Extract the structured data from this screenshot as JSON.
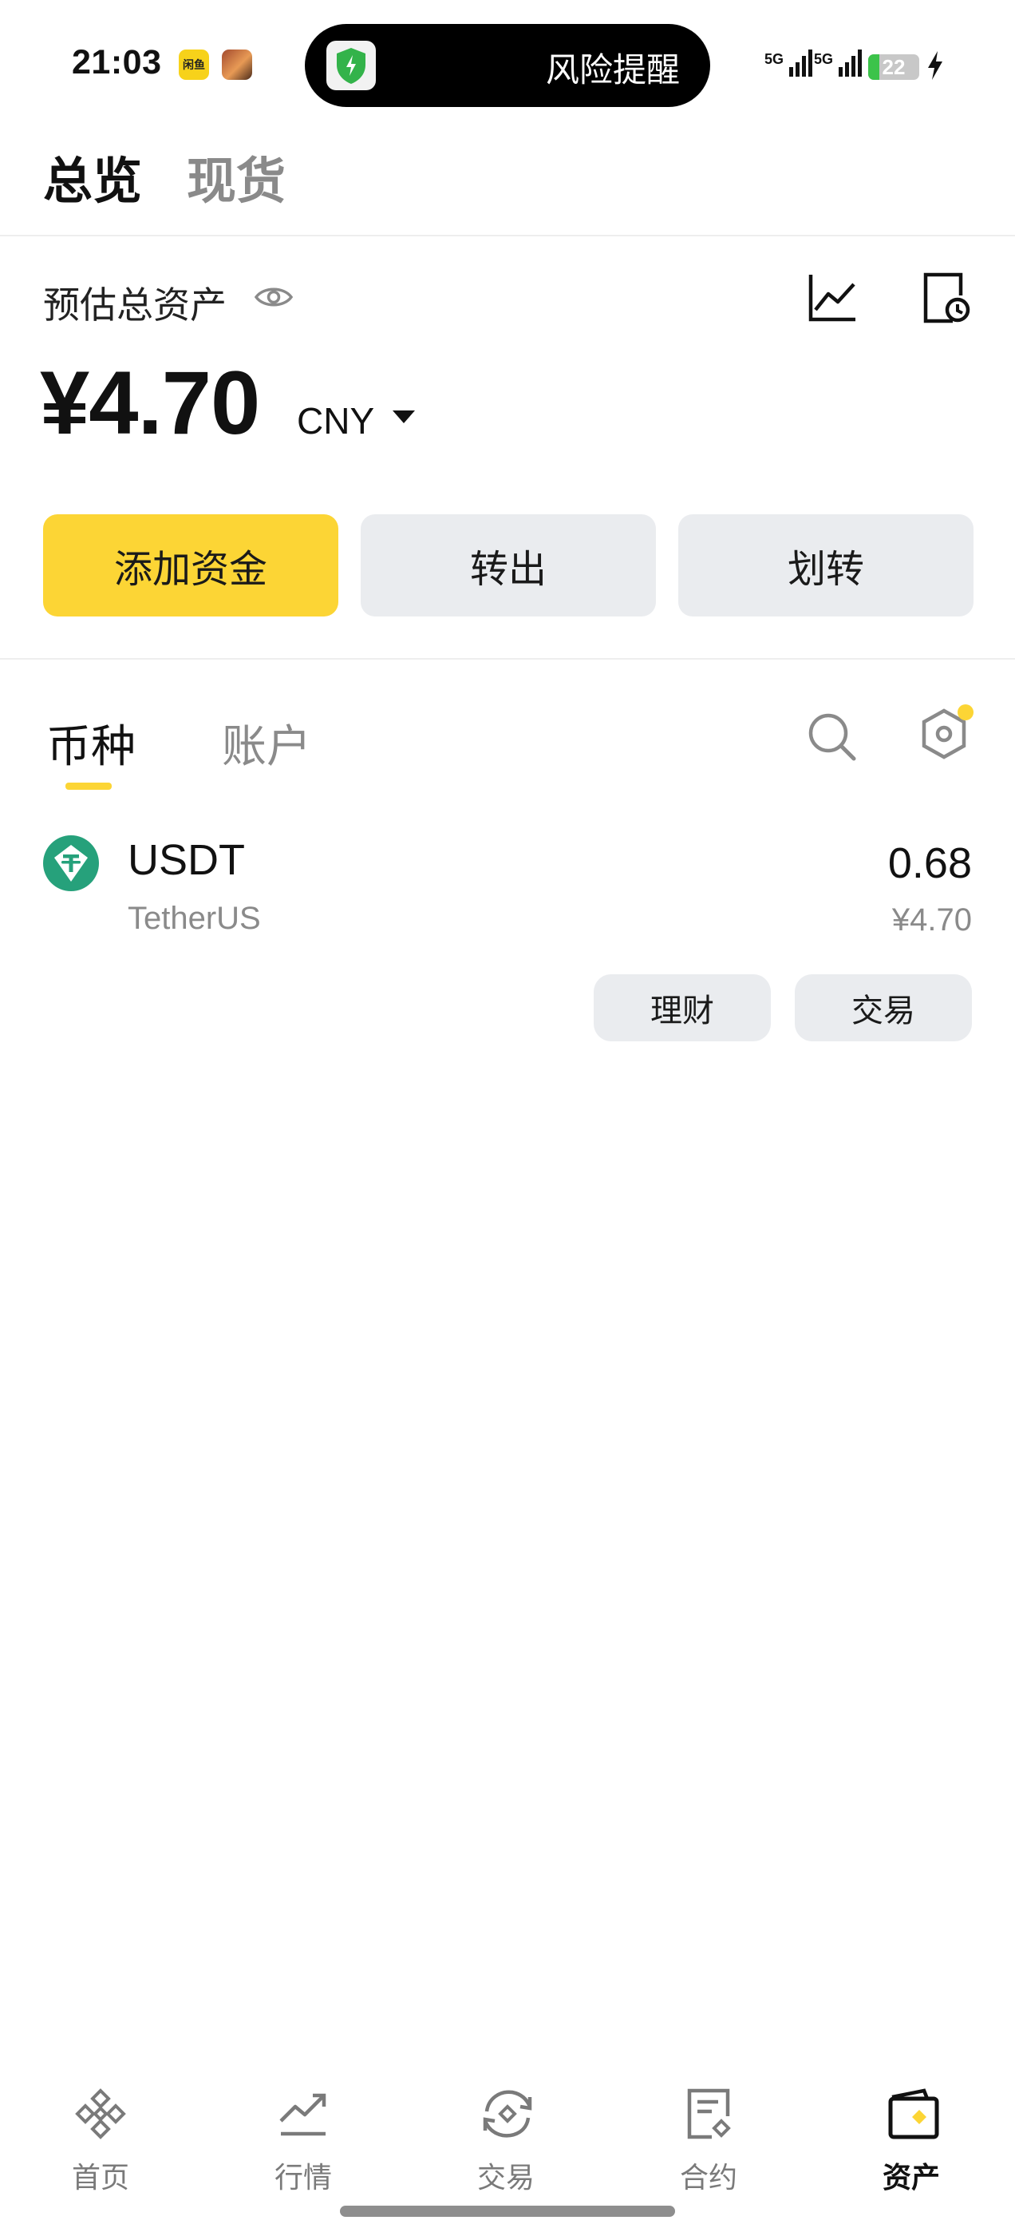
{
  "status_bar": {
    "time": "21:03",
    "badge_text": "闲鱼",
    "alert_text": "风险提醒",
    "network_1": "5G",
    "network_2": "5G",
    "battery_level": "22",
    "battery_fraction": 0.22
  },
  "top_tabs": [
    {
      "label": "总览",
      "active": true
    },
    {
      "label": "现货",
      "active": false
    }
  ],
  "overview": {
    "estimated_label": "预估总资产",
    "total_value": "¥4.70",
    "currency": "CNY"
  },
  "actions": {
    "add_funds": "添加资金",
    "withdraw": "转出",
    "transfer": "划转"
  },
  "asset_tabs": [
    {
      "label": "币种",
      "active": true
    },
    {
      "label": "账户",
      "active": false
    }
  ],
  "coins": [
    {
      "symbol": "USDT",
      "name": "TetherUS",
      "amount": "0.68",
      "fiat_value": "¥4.70",
      "earn_label": "理财",
      "trade_label": "交易"
    }
  ],
  "bottom_nav": [
    {
      "label": "首页",
      "icon": "binance-logo-icon",
      "active": false
    },
    {
      "label": "行情",
      "icon": "markets-trend-icon",
      "active": false
    },
    {
      "label": "交易",
      "icon": "trade-exchange-icon",
      "active": false
    },
    {
      "label": "合约",
      "icon": "futures-document-icon",
      "active": false
    },
    {
      "label": "资产",
      "icon": "wallet-icon",
      "active": true
    }
  ],
  "colors": {
    "brand_yellow": "#fcd535",
    "button_grey": "#eaecef",
    "tether_green": "#26a17b",
    "muted_text": "#8a8a8a"
  }
}
